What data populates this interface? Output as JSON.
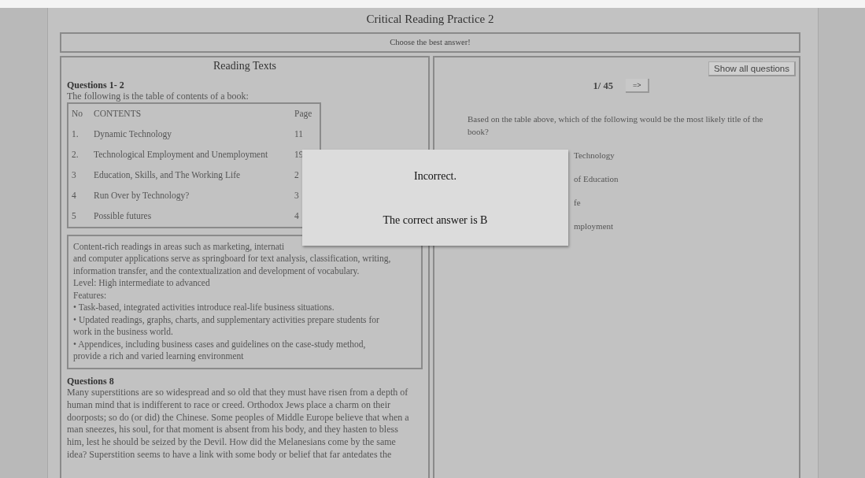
{
  "title": "Critical Reading Practice 2",
  "instruction": "Choose the best answer!",
  "reading": {
    "heading": "Reading Texts",
    "first": {
      "heading": "Questions 1- 2",
      "intro": "The following is the table of contents of a book:",
      "columns": [
        "No",
        "CONTENTS",
        "Page"
      ],
      "rows": [
        [
          "1.",
          "Dynamic Technology",
          "11"
        ],
        [
          "2.",
          "Technological Employment and Unemployment",
          "19"
        ],
        [
          "3",
          "Education, Skills, and The Working Life",
          "2"
        ],
        [
          "4",
          "Run Over by Technology?",
          "3"
        ],
        [
          "5",
          "Possible futures",
          "4"
        ]
      ],
      "box_lines": [
        "Content-rich readings in areas such as marketing, internati",
        "and computer applications serve as springboard for text analysis, classification, writing,",
        "information transfer, and the contextualization and development of vocabulary.",
        "Level: High intermediate to advanced",
        "Features:",
        "• Task-based, integrated activities introduce real-life business situations.",
        "• Updated readings, graphs, charts, and supplementary activities prepare students for",
        "work in the business world.",
        "• Appendices, including business cases and guidelines on the case-study method,",
        "provide a rich and varied learning environment"
      ]
    },
    "second": {
      "heading": "Questions 8",
      "lines": [
        "Many superstitions are so widespread and so old that they must have risen from a depth of",
        "human mind that is indifferent to race or creed. Orthodox Jews place a charm on their",
        "doorposts; so do (or did) the Chinese. Some peoples of Middle Europe believe that when a",
        "man sneezes, his soul, for that moment is absent from his body, and they hasten to bless",
        "him, lest he should be seized by the Devil. How did the Melanesians come by the same",
        "idea? Superstition seems to have a link with some body or belief that far antedates the"
      ]
    }
  },
  "question": {
    "show_all_button": "Show all questions",
    "counter": "1/ 45",
    "next_button": "=>",
    "prompt": "Based on the table above, which of the following would be the most likely title of the book?",
    "options": [
      "Technology",
      "of Education",
      "fe",
      "mployment"
    ]
  },
  "dialog": {
    "message": "Incorrect.",
    "detail": "The correct answer is B"
  }
}
